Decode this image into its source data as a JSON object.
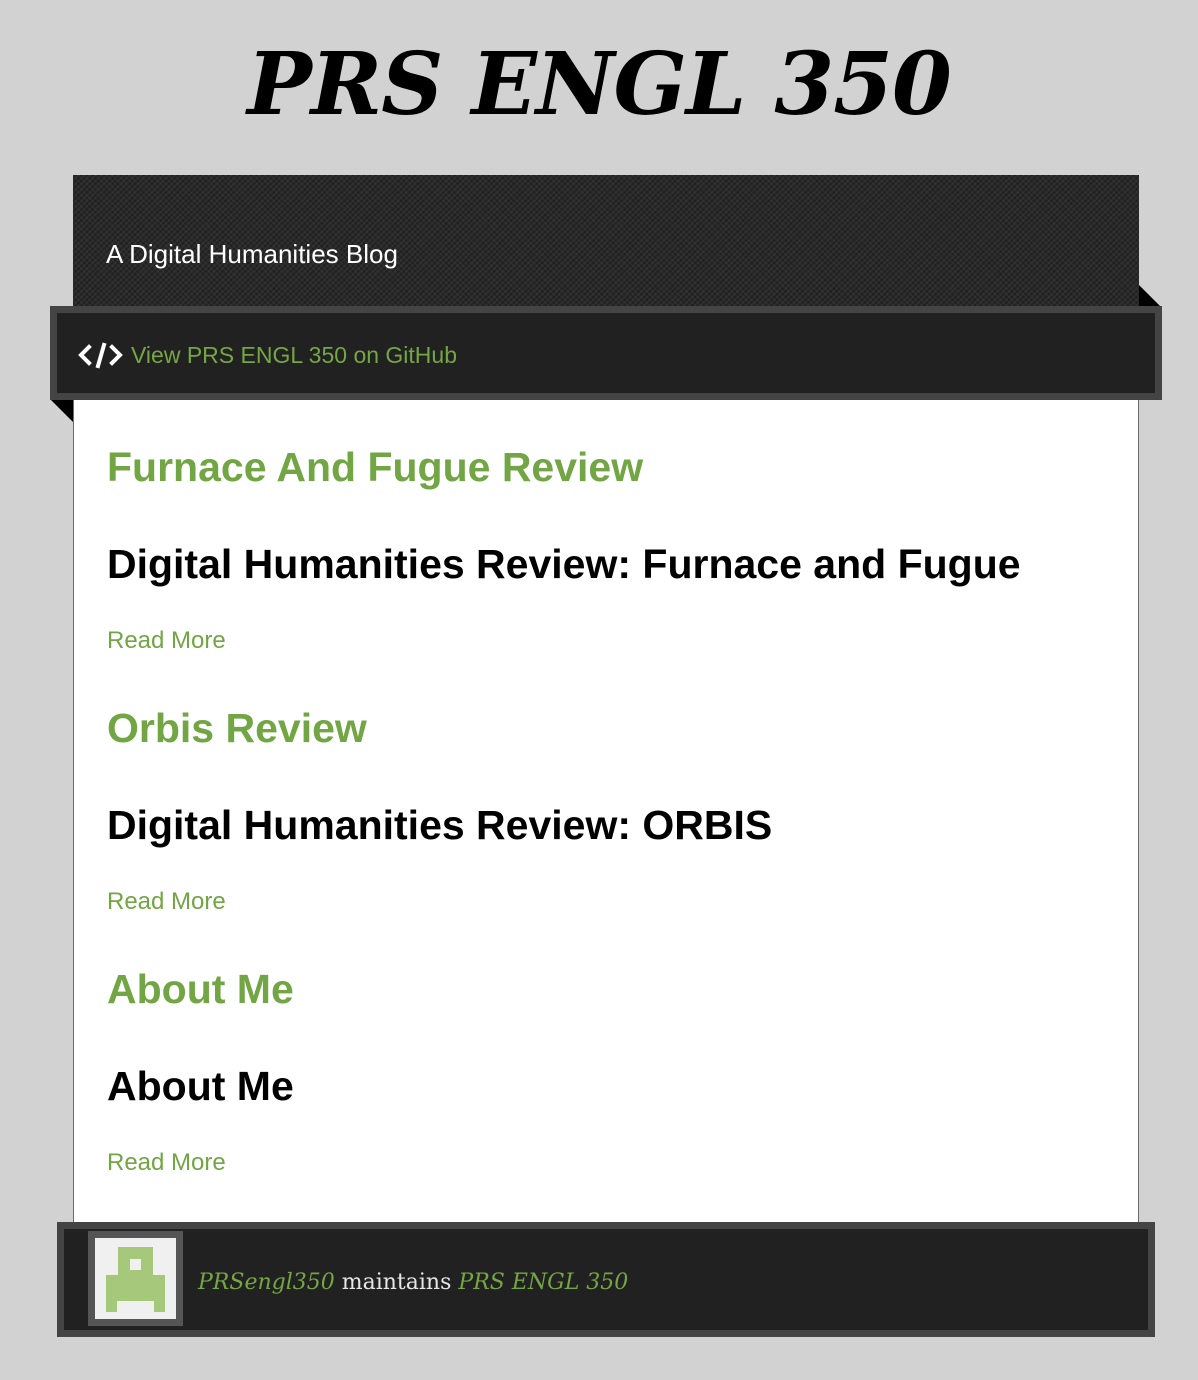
{
  "site": {
    "title": "PRS ENGL 350",
    "tagline": "A Digital Humanities Blog"
  },
  "github": {
    "link_text": "View PRS ENGL 350 on GitHub",
    "icon": "code-icon"
  },
  "posts": [
    {
      "title": "Furnace And Fugue Review",
      "heading": "Digital Humanities Review: Furnace and Fugue",
      "read_more": "Read More"
    },
    {
      "title": "Orbis Review",
      "heading": "Digital Humanities Review: ORBIS",
      "read_more": "Read More"
    },
    {
      "title": "About Me",
      "heading": "About Me",
      "read_more": "Read More"
    }
  ],
  "footer": {
    "user": "PRSengl350",
    "maintains": "maintains",
    "project": "PRS ENGL 350",
    "avatar_icon": "identicon-avatar"
  },
  "colors": {
    "background": "#d2d2d2",
    "accent_green": "#72a543",
    "header_dark": "#212121",
    "avatar_green": "#a6c87a"
  }
}
